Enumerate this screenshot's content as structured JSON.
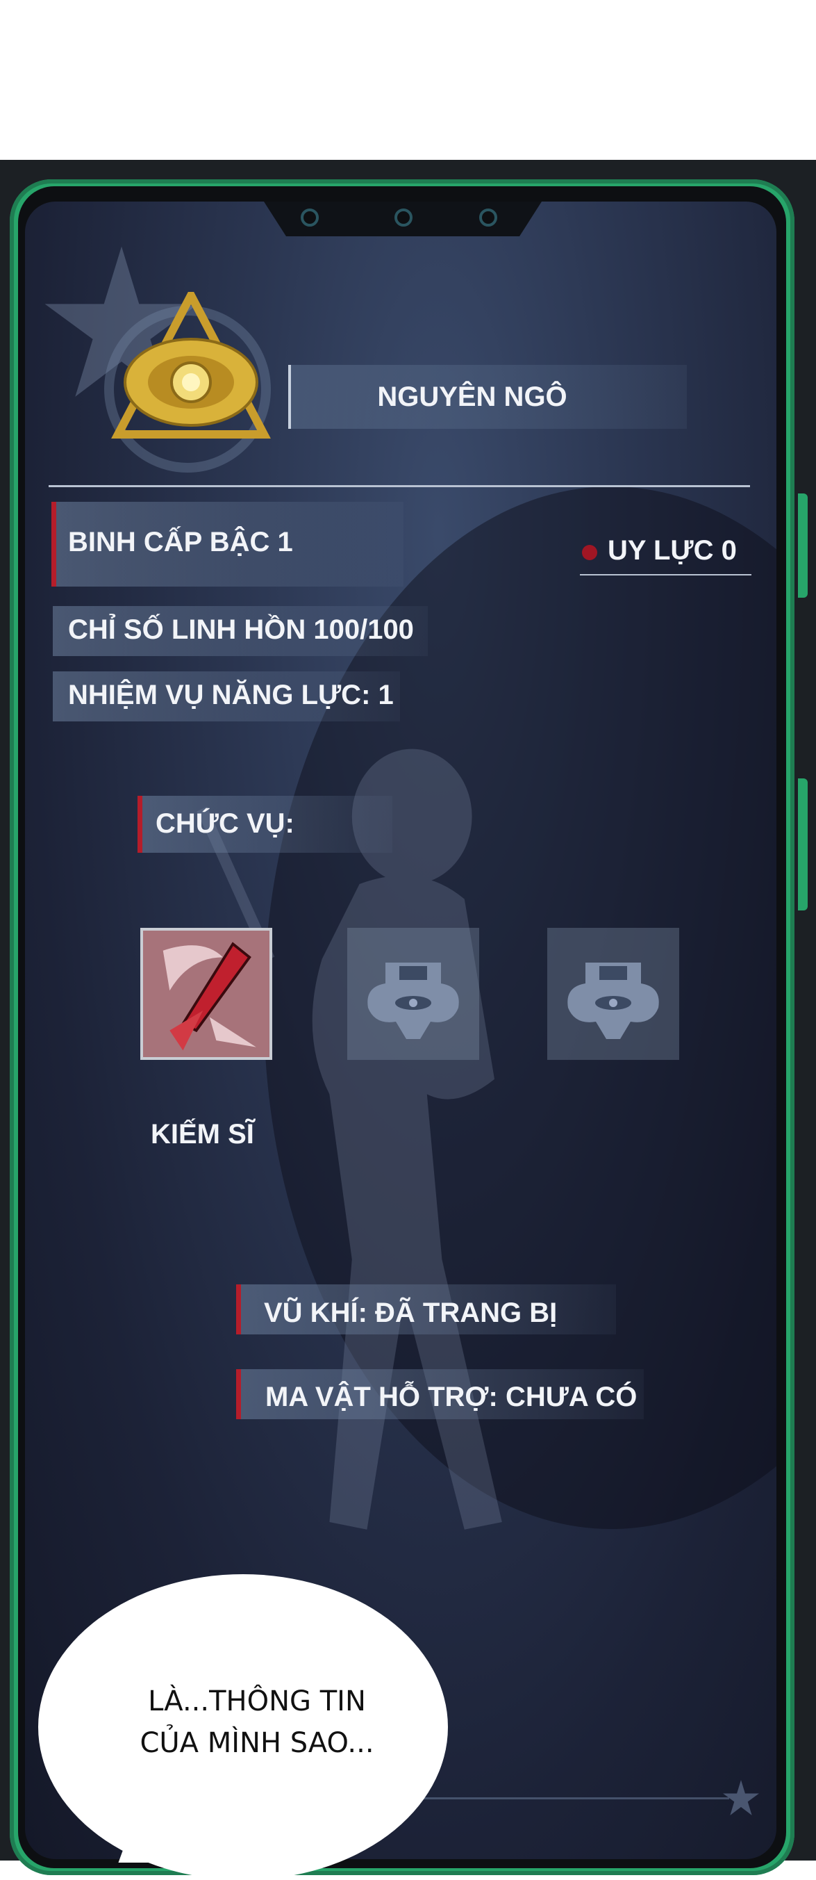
{
  "profile": {
    "name": "NGUYÊN NGÔ"
  },
  "stats": {
    "rank": "BINH CẤP BẬC 1",
    "power": "UY LỰC 0",
    "soul_index": "CHỈ SỐ LINH HỒN 100/100",
    "ability_missions": "NHIỆM VỤ NĂNG LỰC: 1"
  },
  "position": {
    "label": "CHỨC VỤ:",
    "jobs": [
      {
        "name": "KIẾM SĨ",
        "icon": "sword-slash-icon",
        "state": "active"
      },
      {
        "name": "",
        "icon": "locked-helmet-icon",
        "state": "locked"
      },
      {
        "name": "",
        "icon": "locked-helmet-icon",
        "state": "locked"
      }
    ]
  },
  "equipment": {
    "weapon": "VŨ KHÍ: ĐÃ TRANG BỊ",
    "support": "MA VẬT HỖ TRỢ: CHƯA CÓ"
  },
  "dialogue": {
    "line1": "LÀ...THÔNG TIN",
    "line2": "CỦA MÌNH SAO..."
  },
  "colors": {
    "frame": "#27a56a",
    "screen": "#1c2237",
    "accent_red": "#b51d2a",
    "text": "#f2f4f8",
    "emblem_gold": "#d9b23a"
  }
}
